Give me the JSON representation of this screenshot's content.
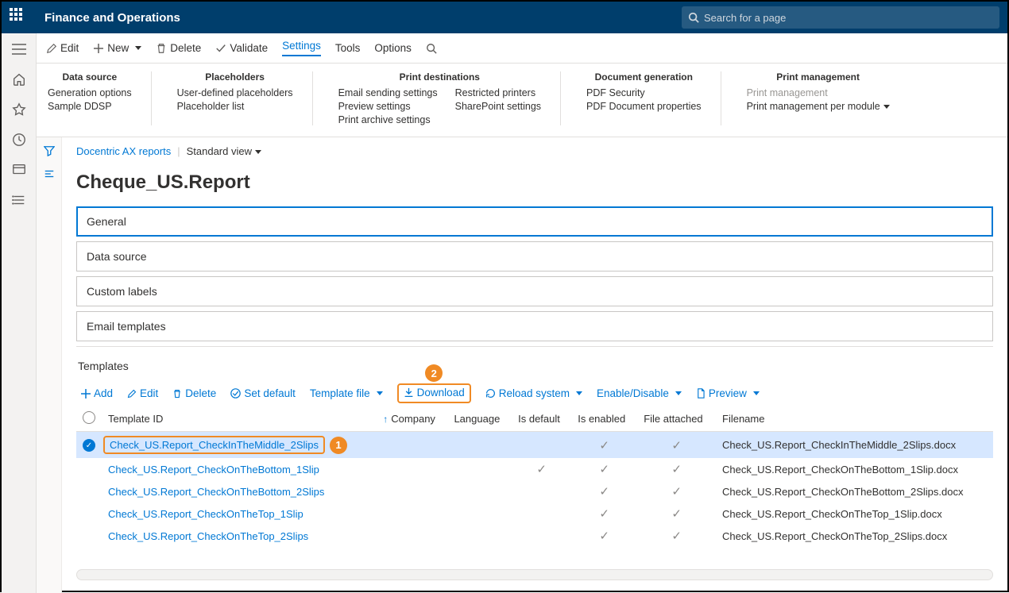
{
  "top": {
    "app_title": "Finance and Operations",
    "search_placeholder": "Search for a page"
  },
  "actionbar": {
    "edit": "Edit",
    "new": "New",
    "delete": "Delete",
    "validate": "Validate",
    "settings": "Settings",
    "tools": "Tools",
    "options": "Options"
  },
  "ribbon": {
    "datasource": {
      "header": "Data source",
      "items": [
        "Generation options",
        "Sample DDSP"
      ]
    },
    "placeholders": {
      "header": "Placeholders",
      "items": [
        "User-defined placeholders",
        "Placeholder list"
      ]
    },
    "printdest": {
      "header": "Print destinations",
      "col1": [
        "Email sending settings",
        "Preview settings",
        "Print archive settings"
      ],
      "col2": [
        "Restricted printers",
        "SharePoint settings"
      ]
    },
    "docgen": {
      "header": "Document generation",
      "items": [
        "PDF Security",
        "PDF Document properties"
      ]
    },
    "printmgmt": {
      "header": "Print management",
      "items": [
        "Print management",
        "Print management per module"
      ]
    }
  },
  "breadcrumb": {
    "link": "Docentric AX reports",
    "view": "Standard view"
  },
  "page_title": "Cheque_US.Report",
  "fasttabs": {
    "general": "General",
    "datasource": "Data source",
    "custom": "Custom labels",
    "email": "Email templates"
  },
  "templates": {
    "section_title": "Templates",
    "toolbar": {
      "add": "Add",
      "edit": "Edit",
      "delete": "Delete",
      "setdefault": "Set default",
      "tfile": "Template file",
      "download": "Download",
      "reload": "Reload system",
      "enable": "Enable/Disable",
      "preview": "Preview"
    },
    "callouts": {
      "row": "1",
      "download": "2"
    },
    "columns": {
      "id": "Template ID",
      "company": "Company",
      "language": "Language",
      "isdefault": "Is default",
      "isenabled": "Is enabled",
      "fileattached": "File attached",
      "filename": "Filename"
    },
    "rows": [
      {
        "selected": true,
        "id": "Check_US.Report_CheckInTheMiddle_2Slips",
        "company": "",
        "lang": "",
        "isdefault": false,
        "isenabled": true,
        "fileattached": true,
        "filename": "Check_US.Report_CheckInTheMiddle_2Slips.docx"
      },
      {
        "selected": false,
        "id": "Check_US.Report_CheckOnTheBottom_1Slip",
        "company": "",
        "lang": "",
        "isdefault": true,
        "isenabled": true,
        "fileattached": true,
        "filename": "Check_US.Report_CheckOnTheBottom_1Slip.docx"
      },
      {
        "selected": false,
        "id": "Check_US.Report_CheckOnTheBottom_2Slips",
        "company": "",
        "lang": "",
        "isdefault": false,
        "isenabled": true,
        "fileattached": true,
        "filename": "Check_US.Report_CheckOnTheBottom_2Slips.docx"
      },
      {
        "selected": false,
        "id": "Check_US.Report_CheckOnTheTop_1Slip",
        "company": "",
        "lang": "",
        "isdefault": false,
        "isenabled": true,
        "fileattached": true,
        "filename": "Check_US.Report_CheckOnTheTop_1Slip.docx"
      },
      {
        "selected": false,
        "id": "Check_US.Report_CheckOnTheTop_2Slips",
        "company": "",
        "lang": "",
        "isdefault": false,
        "isenabled": true,
        "fileattached": true,
        "filename": "Check_US.Report_CheckOnTheTop_2Slips.docx"
      }
    ]
  }
}
